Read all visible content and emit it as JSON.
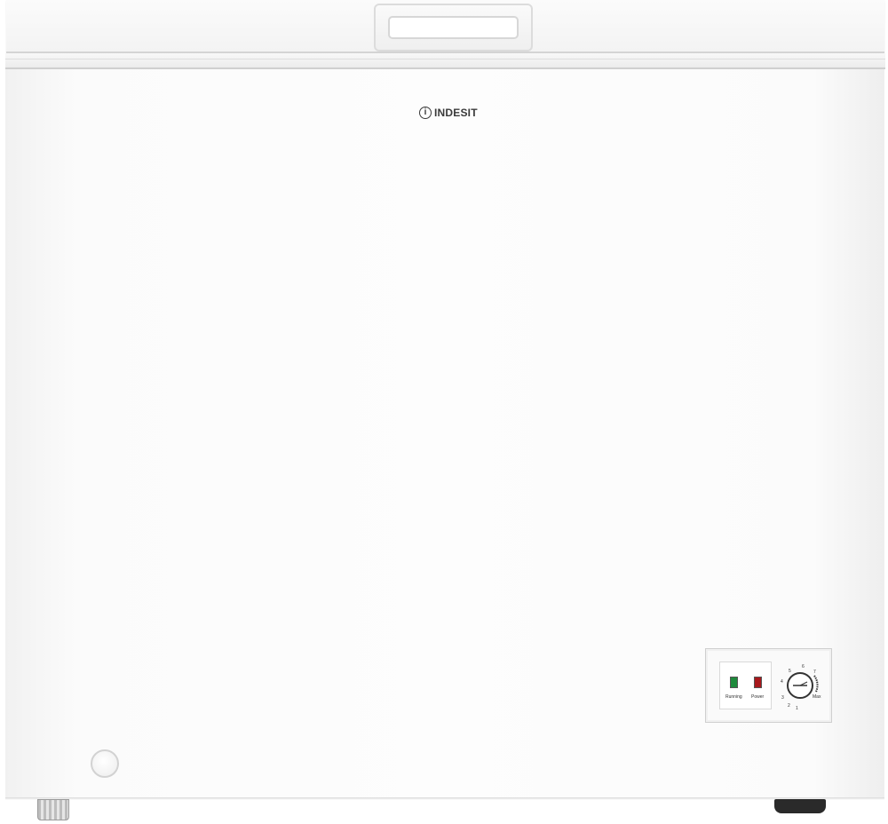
{
  "appliance": {
    "brand": "INDESIT",
    "brand_mark": "i"
  },
  "control_panel": {
    "indicators": [
      {
        "label": "Running",
        "color": "#1e8a3c"
      },
      {
        "label": "Power",
        "color": "#a8181c"
      }
    ],
    "dial": {
      "scale_labels": [
        "1",
        "2",
        "3",
        "4",
        "5",
        "6",
        "7",
        "Max"
      ]
    }
  }
}
